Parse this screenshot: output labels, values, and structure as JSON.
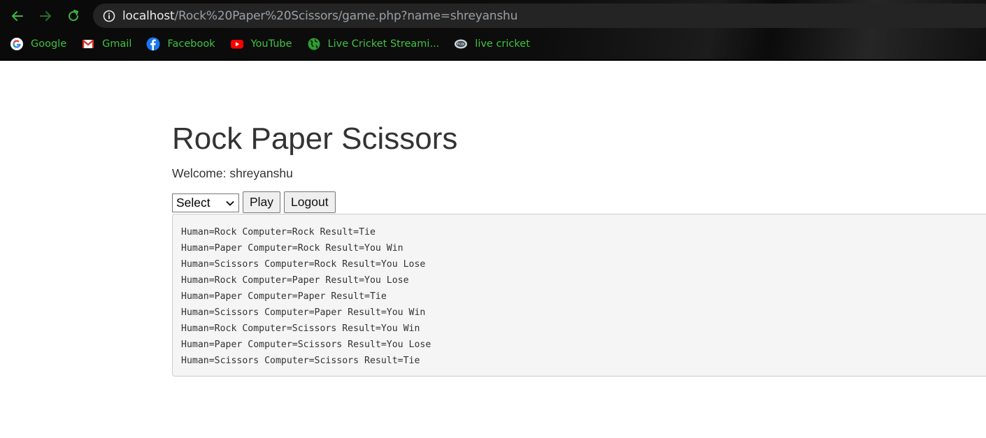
{
  "browser": {
    "url_host": "localhost",
    "url_path": "/Rock%20Paper%20Scissors/game.php?name=shreyanshu",
    "bookmarks": [
      {
        "label": "Google",
        "icon": "google-icon"
      },
      {
        "label": "Gmail",
        "icon": "gmail-icon"
      },
      {
        "label": "Facebook",
        "icon": "facebook-icon"
      },
      {
        "label": "YouTube",
        "icon": "youtube-icon"
      },
      {
        "label": "Live Cricket Streami...",
        "icon": "globe-icon"
      },
      {
        "label": "live cricket",
        "icon": "fox-icon"
      }
    ]
  },
  "page": {
    "title": "Rock Paper Scissors",
    "welcome": "Welcome: shreyanshu",
    "select_value": "Select",
    "play_label": "Play",
    "logout_label": "Logout",
    "results": [
      "Human=Rock Computer=Rock Result=Tie",
      "Human=Paper Computer=Rock Result=You Win",
      "Human=Scissors Computer=Rock Result=You Lose",
      "Human=Rock Computer=Paper Result=You Lose",
      "Human=Paper Computer=Paper Result=Tie",
      "Human=Scissors Computer=Paper Result=You Win",
      "Human=Rock Computer=Scissors Result=You Win",
      "Human=Paper Computer=Scissors Result=You Lose",
      "Human=Scissors Computer=Scissors Result=Tie"
    ]
  },
  "colors": {
    "bookmark_text": "#3fc43f",
    "nav_green": "#3fb83f",
    "page_text": "#333333",
    "results_bg": "#f5f5f5"
  }
}
